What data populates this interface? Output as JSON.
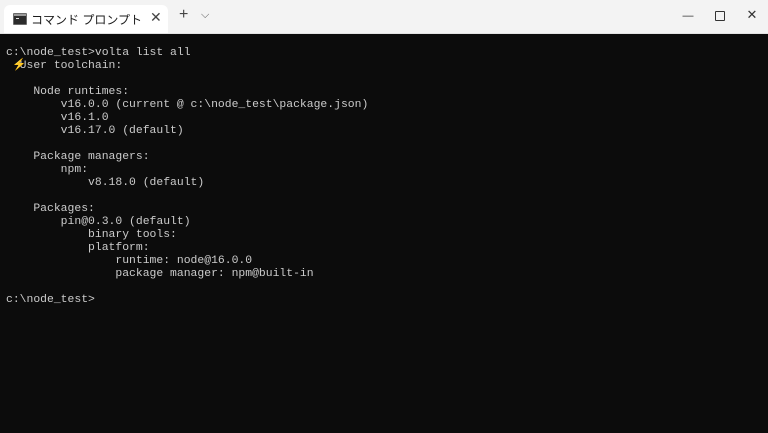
{
  "titlebar": {
    "tab_title": "コマンド プロンプト",
    "close_tab_glyph": "✕",
    "new_tab_glyph": "+",
    "dropdown_glyph": "⌵",
    "minimize_glyph": "—",
    "close_glyph": "✕"
  },
  "terminal": {
    "lines": [
      "c:\\node_test>volta list all",
      "  User toolchain:",
      "",
      "    Node runtimes:",
      "        v16.0.0 (current @ c:\\node_test\\package.json)",
      "        v16.1.0",
      "        v16.17.0 (default)",
      "",
      "    Package managers:",
      "        npm:",
      "            v8.18.0 (default)",
      "",
      "    Packages:",
      "        pin@0.3.0 (default)",
      "            binary tools:",
      "            platform:",
      "                runtime: node@16.0.0",
      "                package manager: npm@built-in",
      "",
      "c:\\node_test>"
    ],
    "bolt_glyph": "⚡"
  },
  "colors": {
    "terminal_bg": "#0c0c0c",
    "terminal_fg": "#cccccc",
    "accent_bolt": "#f08c2e",
    "titlebar_bg": "#f3f3f3"
  }
}
